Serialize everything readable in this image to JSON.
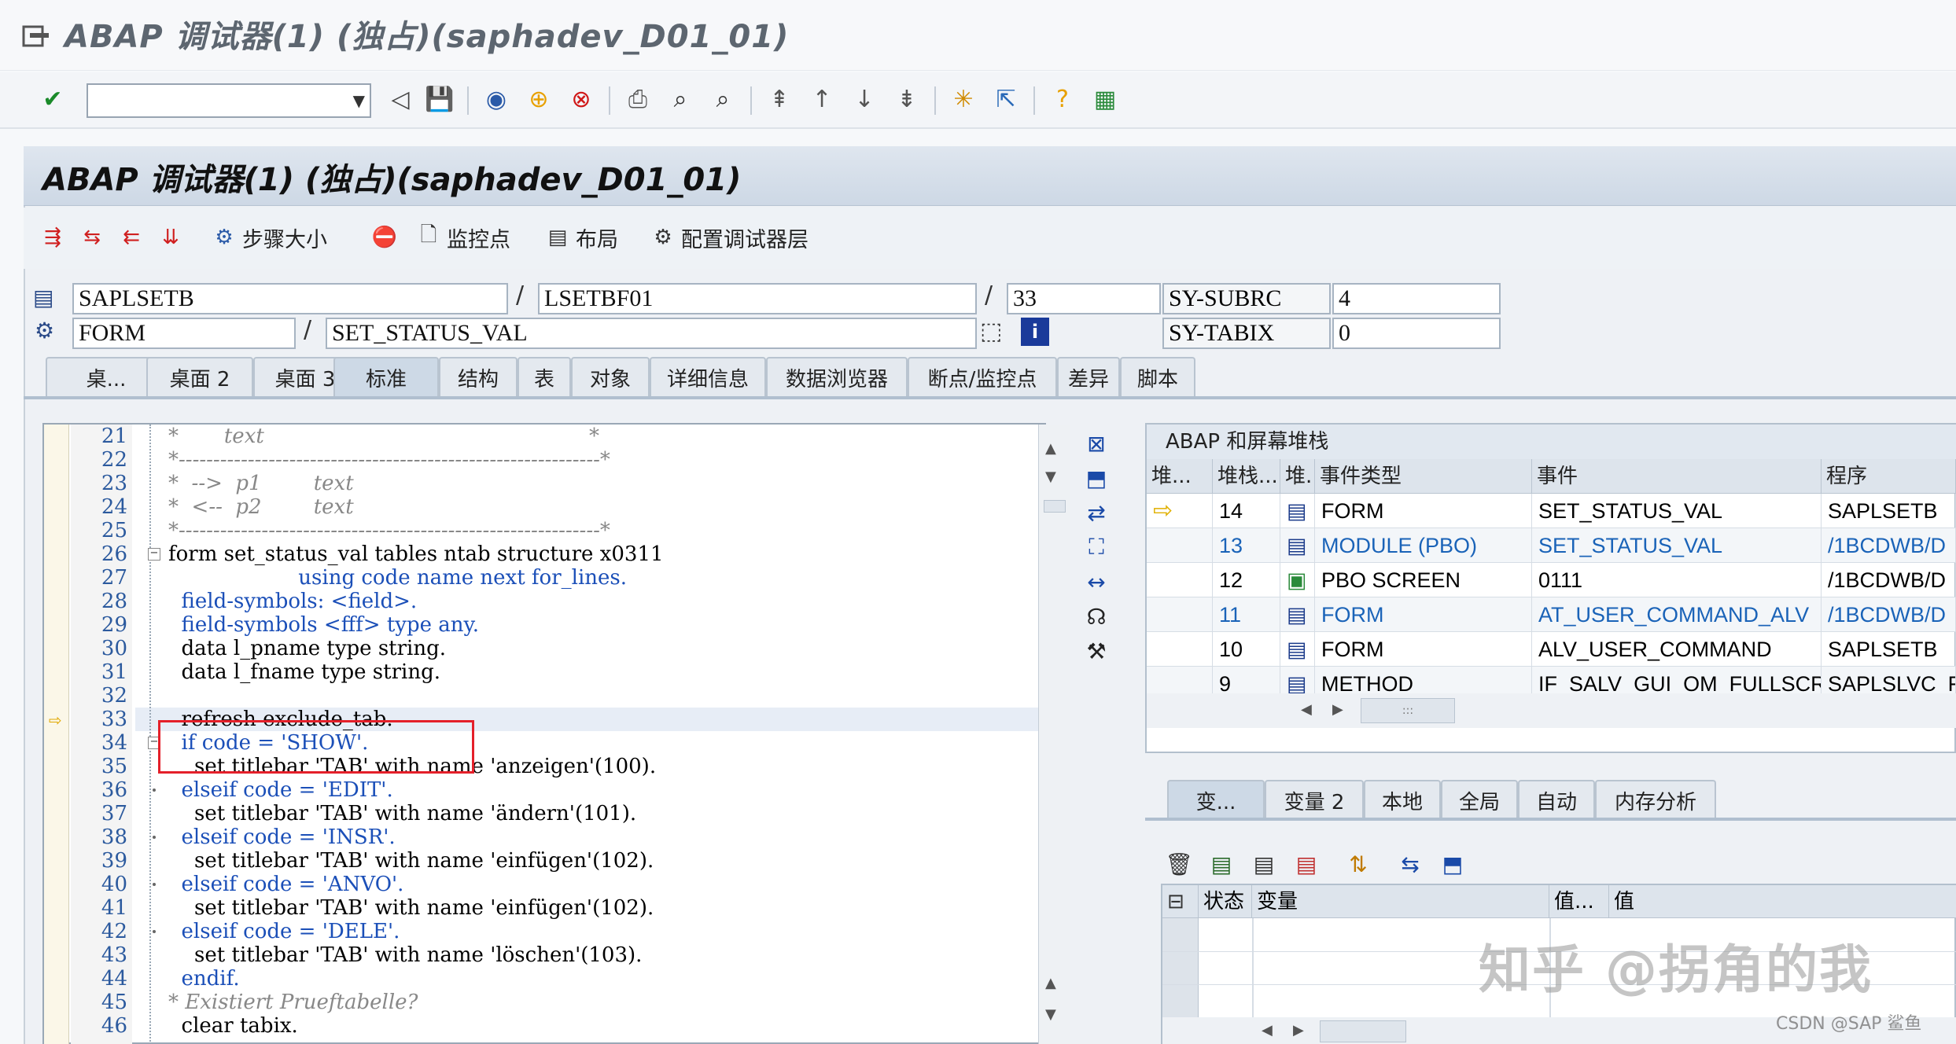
{
  "window": {
    "title": "ABAP 调试器(1) (独占)(saphadev_D01_01)"
  },
  "debugger": {
    "title": "ABAP 调试器(1) (独占)(saphadev_D01_01)"
  },
  "toolbar": {
    "command_value": ""
  },
  "app_toolbar": {
    "step_size": "步骤大小",
    "watchpoint": "监控点",
    "layout": "布局",
    "config_layers": "配置调试器层"
  },
  "context": {
    "program": "SAPLSETB",
    "include": "LSETBF01",
    "line": "33",
    "subrc_label": "SY-SUBRC",
    "subrc_value": "4",
    "event_type": "FORM",
    "event_name": "SET_STATUS_VAL",
    "tabix_label": "SY-TABIX",
    "tabix_value": "0"
  },
  "tabs": [
    "桌...",
    "桌面 2",
    "桌面 3",
    "标准",
    "结构",
    "表",
    "对象",
    "详细信息",
    "数据浏览器",
    "断点/监控点",
    "差异",
    "脚本"
  ],
  "code": {
    "line_numbers": [
      "21",
      "22",
      "23",
      "24",
      "25",
      "26",
      "27",
      "28",
      "29",
      "30",
      "31",
      "32",
      "33",
      "34",
      "35",
      "36",
      "37",
      "38",
      "39",
      "40",
      "41",
      "42",
      "43",
      "44",
      "45",
      "46"
    ],
    "lines": [
      "*       text                                                  *",
      "*-------------------------------------------------------------*",
      "*  -->  p1        text",
      "*  <--  p2        text",
      "*-------------------------------------------------------------*",
      "form set_status_val tables ntab structure x0311",
      "                    using code name next for_lines.",
      "  field-symbols: <field>.",
      "  field-symbols <fff> type any.",
      "  data l_pname type string.",
      "  data l_fname type string.",
      "",
      "  refresh exclude_tab.",
      "  if code = 'SHOW'.",
      "    set titlebar 'TAB' with name 'anzeigen'(100).",
      "  elseif code = 'EDIT'.",
      "    set titlebar 'TAB' with name 'ändern'(101).",
      "  elseif code = 'INSR'.",
      "    set titlebar 'TAB' with name 'einfügen'(102).",
      "  elseif code = 'ANVO'.",
      "    set titlebar 'TAB' with name 'einfügen'(102).",
      "  elseif code = 'DELE'.",
      "    set titlebar 'TAB' with name 'löschen'(103).",
      "  endif.",
      "* Existiert Prueftabelle?",
      "  clear tabix."
    ]
  },
  "stack": {
    "title": "ABAP 和屏幕堆栈",
    "headers": [
      "堆...",
      "堆栈...",
      "堆.",
      "事件类型",
      "事件",
      "程序"
    ],
    "rows": [
      {
        "level": "14",
        "type": "FORM",
        "event": "SET_STATUS_VAL",
        "program": "SAPLSETB"
      },
      {
        "level": "13",
        "type": "MODULE (PBO)",
        "event": "SET_STATUS_VAL",
        "program": "/1BCDWB/D"
      },
      {
        "level": "12",
        "type": "PBO SCREEN",
        "event": "0111",
        "program": "/1BCDWB/D"
      },
      {
        "level": "11",
        "type": "FORM",
        "event": "AT_USER_COMMAND_ALV",
        "program": "/1BCDWB/D"
      },
      {
        "level": "10",
        "type": "FORM",
        "event": "ALV_USER_COMMAND",
        "program": "SAPLSETB"
      },
      {
        "level": "9",
        "type": "METHOD",
        "event": "IF_SALV_GUI_OM_FULLSCRE...",
        "program": "SAPLSLVC_F"
      }
    ],
    "scroll_label": ":::"
  },
  "var_tabs": [
    "变...",
    "变量 2",
    "本地",
    "全局",
    "自动",
    "内存分析"
  ],
  "var_table": {
    "headers": [
      "状态",
      "变量",
      "值...",
      "值"
    ]
  },
  "watermark": "知乎 @拐角的我",
  "credit": "CSDN @SAP 鲨鱼",
  "colors": {
    "accent": "#1a63b8",
    "highlight_box": "#e4202a",
    "header_bg": "#cdd8e5"
  }
}
